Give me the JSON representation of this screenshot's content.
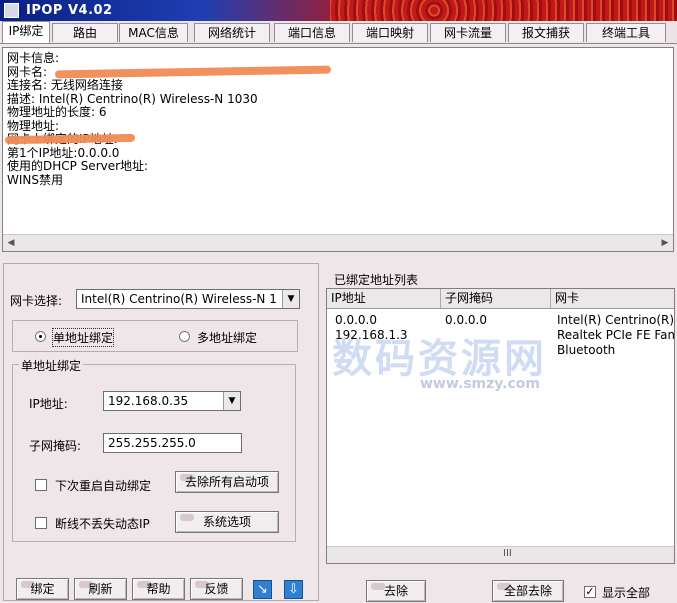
{
  "window": {
    "title": "IPOP V4.02"
  },
  "tabs": [
    "IP绑定",
    "路由",
    "MAC信息",
    "网络统计",
    "端口信息",
    "端口映射",
    "网卡流量",
    "报文捕获",
    "终端工具"
  ],
  "info_lines": [
    "网卡信息:",
    "网卡名:",
    "连接名: 无线网络连接",
    "描述: Intel(R) Centrino(R) Wireless-N 1030",
    "物理地址的长度: 6",
    "物理地址:",
    "",
    "网卡上绑定的IP地址:",
    "第1个IP地址:0.0.0.0",
    "使用的DHCP Server地址:",
    "",
    "WINS禁用"
  ],
  "left": {
    "nic_label": "网卡选择:",
    "nic_value": "Intel(R) Centrino(R) Wireless-N 1",
    "radio_single": "单地址绑定",
    "radio_multi": "多地址绑定",
    "group_title": "单地址绑定",
    "ip_label": "IP地址:",
    "ip_value": "192.168.0.35",
    "mask_label": "子网掩码:",
    "mask_value": "255.255.255.0",
    "chk_restart": "下次重启自动绑定",
    "btn_remove_startup": "去除所有启动项",
    "chk_keep": "断线不丢失动态IP",
    "btn_sys_options": "系统选项",
    "btn_bind": "绑定",
    "btn_refresh": "刷新",
    "btn_help": "帮助",
    "btn_feedback": "反馈"
  },
  "right": {
    "list_title": "已绑定地址列表",
    "columns": [
      "IP地址",
      "子网掩码",
      "网卡"
    ],
    "rows": [
      [
        "0.0.0.0",
        "0.0.0.0",
        "Intel(R) Centrino(R)"
      ],
      [
        "192.168.1.3",
        "",
        "Realtek PCIe FE Fam"
      ],
      [
        "",
        "",
        "Bluetooth"
      ]
    ],
    "scroll_glyph": "III",
    "btn_remove": "去除",
    "btn_remove_all": "全部去除",
    "chk_show_all": "显示全部"
  },
  "watermark": {
    "text": "数码资源网",
    "url": "www.smzy.com"
  }
}
